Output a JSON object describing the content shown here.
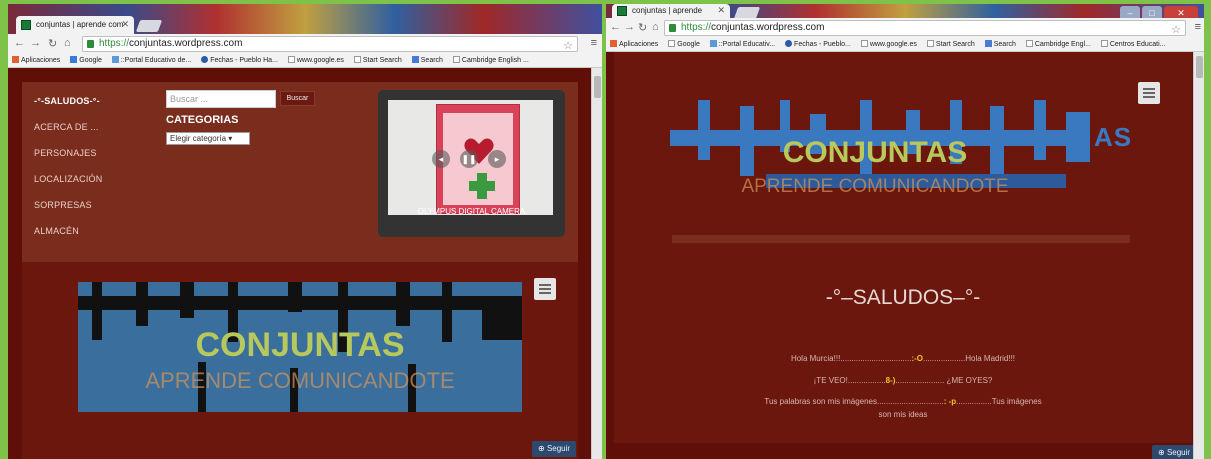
{
  "left": {
    "tab_title": "conjuntas | aprende com",
    "url_scheme": "https://",
    "url_host": "conjuntas.wordpress.com",
    "bookmarks": [
      "Aplicaciones",
      "Google",
      "::Portal Educativo de...",
      "Fechas - Pueblo Ha...",
      "www.google.es",
      "Start Search",
      "Search",
      "Cambridge English ..."
    ],
    "menu": [
      "-°-SALUDOS-°-",
      "ACERCA DE ...",
      "PERSONAJES",
      "LOCALIZACIÓN",
      "SORPRESAS",
      "ALMACÉN"
    ],
    "search_placeholder": "Buscar ...",
    "search_button": "Buscar",
    "categories_title": "CATEGORIAS",
    "categories_select": "Elegir categoría",
    "photo_caption": "OLYMPUS DIGITAL CAMERA",
    "logo_title": "CONJUNTAS",
    "logo_subtitle": "APRENDE COMUNICANDOTE",
    "follow": "Seguir"
  },
  "right": {
    "tab_title": "conjuntas | aprende",
    "url_scheme": "https://",
    "url_host": "conjuntas.wordpress.com",
    "bookmarks": [
      "Aplicaciones",
      "Google",
      "::Portal Educativ...",
      "Fechas - Pueblo...",
      "www.google.es",
      "Start Search",
      "Search",
      "Cambridge Engl...",
      "Centros Educati..."
    ],
    "logo_title": "CONJUNTAS",
    "logo_subtitle": "APRENDE COMUNICANDOTE",
    "logo_suffix": "AS",
    "post_title": "-°–SALUDOS–°-",
    "line1_a": "Hola Murcia!!!................................",
    "line1_hl": ":-O",
    "line1_b": "...................Hola Madrid!!!",
    "line2_a": "¡TE VEO!.................",
    "line2_hl": "8-)",
    "line2_b": "...................... ¿ME OYES?",
    "line3_a": "Tus palabras son mis imágenes..............................",
    "line3_hl": ": -p",
    "line3_b": "................Tus imágenes",
    "line4": "son mis ideas",
    "follow": "Seguir"
  },
  "colors": {
    "page_bg": "#6b170e",
    "panel": "#7a2c1d",
    "logo_blue": "#3a78c0",
    "logo_green": "#b7c85c",
    "highlight": "#f2c230",
    "desktop": "#7ec24a"
  },
  "icons": [
    "back-icon",
    "forward-icon",
    "reload-icon",
    "home-icon",
    "lock-icon",
    "star-icon",
    "menu-icon",
    "hamburger-icon",
    "follow-icon",
    "heart-icon"
  ]
}
